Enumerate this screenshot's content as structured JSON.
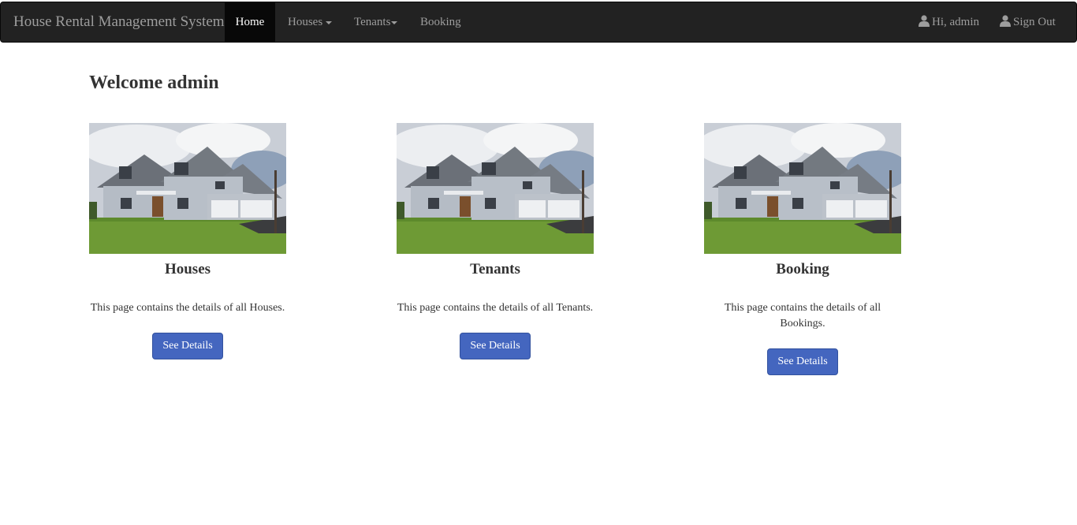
{
  "navbar": {
    "brand": "House Rental Management System",
    "items": [
      {
        "label": "Home",
        "active": true
      },
      {
        "label": "Houses",
        "dropdown": true
      },
      {
        "label": "Tenants",
        "dropdown": true
      },
      {
        "label": "Booking"
      }
    ],
    "user": {
      "greeting": "Hi, admin",
      "icon": "user-icon"
    },
    "signout": {
      "label": "Sign Out",
      "icon": "user-icon"
    }
  },
  "main": {
    "welcome": "Welcome admin",
    "cards": [
      {
        "title": "Houses",
        "description": "This page contains the details of all Houses.",
        "button": "See Details"
      },
      {
        "title": "Tenants",
        "description": "This page contains the details of all Tenants.",
        "button": "See Details"
      },
      {
        "title": "Booking",
        "description": "This page contains the details of all Bookings.",
        "button": "See Details"
      }
    ]
  },
  "colors": {
    "navbar": "#222222",
    "button": "#4466bf",
    "text": "#333333"
  }
}
